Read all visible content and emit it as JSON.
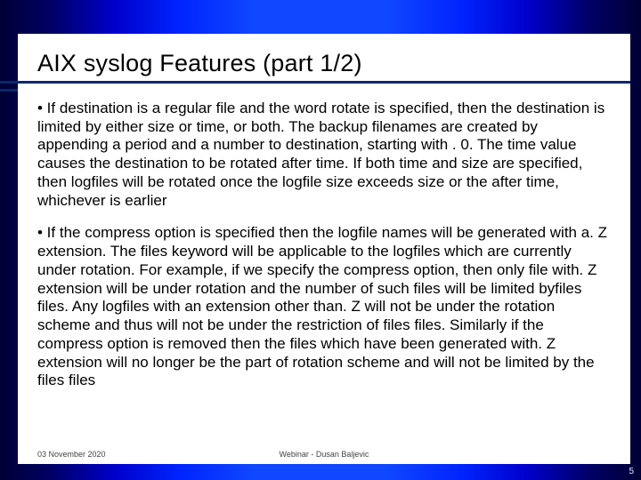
{
  "slide": {
    "title": "AIX syslog Features (part 1/2)",
    "paragraphs": [
      "• If destination is a regular file and the word rotate is specified, then the destination is limited by either size or time, or both. The backup filenames are created by appending a period and a number to destination, starting with . 0. The time value causes the destination to be rotated after time. If both time and size are specified, then logfiles will be rotated once the logfile size exceeds size or the after time, whichever is earlier",
      "• If the compress option is specified then the logfile names will be generated with a. Z extension. The files keyword will be applicable to the logfiles which are currently under rotation. For example, if we specify the compress option, then only file with. Z extension will be under rotation and the number of such files will be limited byfiles files. Any logfiles with an extension other than. Z will not be under the rotation scheme and thus will not be under the restriction of files files. Similarly if the compress option is removed then the files which have been generated with. Z extension will no longer be the part of rotation scheme and will not be limited by the files files"
    ]
  },
  "footer": {
    "date": "03 November 2020",
    "center": "Webinar - Dusan Baljevic",
    "page": "5"
  }
}
